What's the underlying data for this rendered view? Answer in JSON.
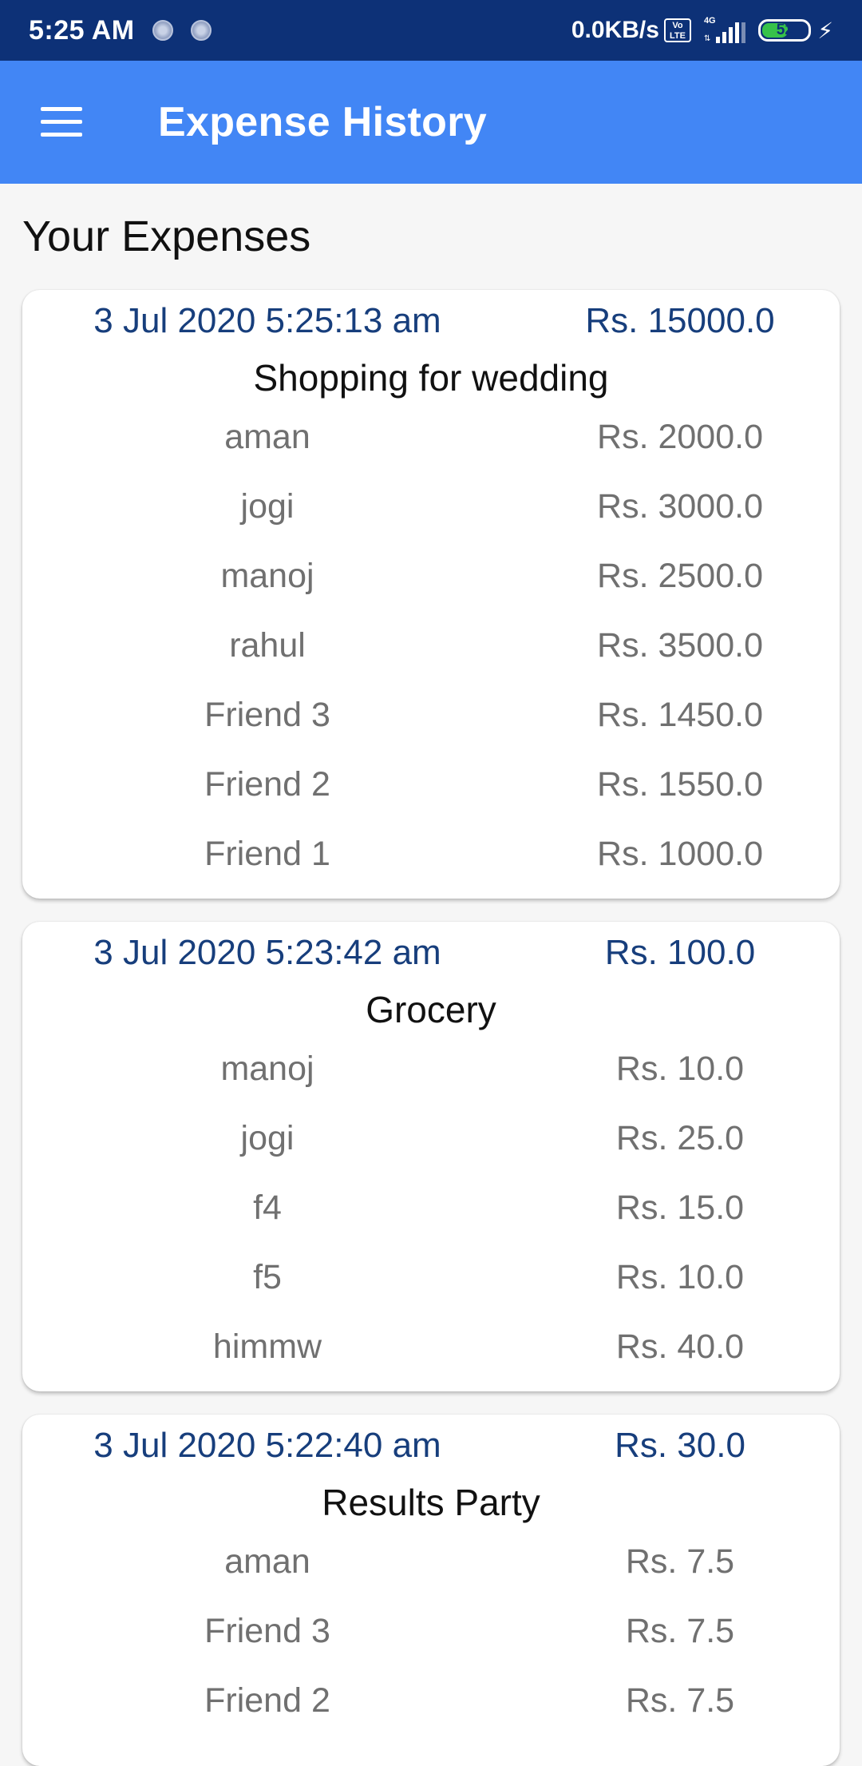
{
  "status_bar": {
    "time": "5:25 AM",
    "net_speed": "0.0KB/s",
    "volte": "Vo LTE",
    "network": "4G",
    "battery": "52"
  },
  "app_bar": {
    "title": "Expense History"
  },
  "section_title": "Your Expenses",
  "expenses": [
    {
      "date": "3 Jul 2020 5:25:13 am",
      "total": "Rs. 15000.0",
      "description": "Shopping for wedding",
      "shares": [
        {
          "name": "aman",
          "amount": "Rs. 2000.0"
        },
        {
          "name": "jogi",
          "amount": "Rs. 3000.0"
        },
        {
          "name": "manoj",
          "amount": "Rs. 2500.0"
        },
        {
          "name": "rahul",
          "amount": "Rs. 3500.0"
        },
        {
          "name": "Friend 3",
          "amount": "Rs. 1450.0"
        },
        {
          "name": "Friend 2",
          "amount": "Rs. 1550.0"
        },
        {
          "name": "Friend 1",
          "amount": "Rs. 1000.0"
        }
      ]
    },
    {
      "date": "3 Jul 2020 5:23:42 am",
      "total": "Rs. 100.0",
      "description": "Grocery",
      "shares": [
        {
          "name": "manoj",
          "amount": "Rs. 10.0"
        },
        {
          "name": "jogi",
          "amount": "Rs. 25.0"
        },
        {
          "name": "f4",
          "amount": "Rs. 15.0"
        },
        {
          "name": "f5",
          "amount": "Rs. 10.0"
        },
        {
          "name": "himmw",
          "amount": "Rs. 40.0"
        }
      ]
    },
    {
      "date": "3 Jul 2020 5:22:40 am",
      "total": "Rs. 30.0",
      "description": "Results Party",
      "shares": [
        {
          "name": "aman",
          "amount": "Rs. 7.5"
        },
        {
          "name": "Friend 3",
          "amount": "Rs. 7.5"
        },
        {
          "name": "Friend 2",
          "amount": "Rs. 7.5"
        }
      ]
    }
  ]
}
